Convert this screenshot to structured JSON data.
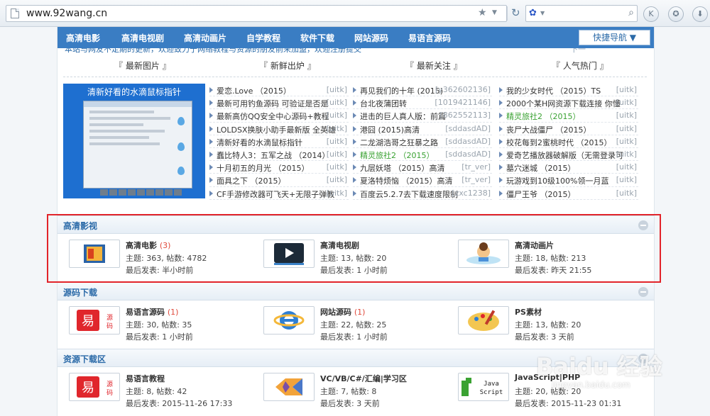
{
  "browser": {
    "url": "www.92wang.cn"
  },
  "nav": {
    "items": [
      "高清电影",
      "高清电视剧",
      "高清动画片",
      "自学教程",
      "软件下载",
      "网站源码",
      "易语言源码"
    ],
    "quick_nav": "快捷导航 ▼"
  },
  "marquee": {
    "left": "本站与网友不定期的更新，欢迎致力于网络教程与资源的朋友前来加盟，欢迎注册提交",
    "right": "下一"
  },
  "sections": [
    "『 最新图片 』",
    "『 新鲜出炉 』",
    "『 最新关注 』",
    "『 人气热门 』"
  ],
  "slide": {
    "caption": "清新好看的水滴鼠标指针"
  },
  "lists": {
    "fresh": [
      {
        "t": "爱恋.Love （2015）",
        "a": "[uitk]"
      },
      {
        "t": "最新可用钓鱼源码 可验证是否是",
        "a": "[uitk]"
      },
      {
        "t": "最新高仿QQ安全中心源码+教程",
        "a": "[uitk]"
      },
      {
        "t": "LOLDSX换肤小助手最新版 全英雄",
        "a": "[uitk]"
      },
      {
        "t": "清新好看的水滴鼠标指针",
        "a": "[uitk]"
      },
      {
        "t": "蠢比特人3：五军之战 （2014）",
        "a": "[uitk]"
      },
      {
        "t": "十月初五的月光 （2015）",
        "a": "[uitk]"
      },
      {
        "t": "面具之下 （2015）",
        "a": "[uitk]"
      },
      {
        "t": "CF手游修改器可飞天+无限子弹教",
        "a": "[uitk]"
      }
    ],
    "focus": [
      {
        "t": "再见我们的十年 (2015)",
        "a": "[y362602136]"
      },
      {
        "t": "台北夜蒲团转",
        "a": "[1019421146]"
      },
      {
        "t": "进击的巨人真人版：前篇",
        "a": "[862552113]"
      },
      {
        "t": "港囧 (2015)高清",
        "a": "[sddasdAD]"
      },
      {
        "t": "二龙湖浩哥之狂暴之路",
        "a": "[sddasdAD]"
      },
      {
        "t": "精灵旅社2 （2015）",
        "a": "[sddasdAD]",
        "green": true
      },
      {
        "t": "九层妖塔 （2015）高清",
        "a": "[tr_ver]"
      },
      {
        "t": "夏洛特烦恼 （2015）高清",
        "a": "[tr_ver]"
      },
      {
        "t": "百度云5.2.7去下载速度限制",
        "a": "[zxc1238]"
      }
    ],
    "hot": [
      {
        "t": "我的少女时代 （2015）TS",
        "a": "[uitk]"
      },
      {
        "t": "2000个某H网资源下载连接 你懂",
        "a": "[uitk]"
      },
      {
        "t": "精灵旅社2 （2015）",
        "a": "[uitk]",
        "green": true
      },
      {
        "t": "丧尸大战僵尸 （2015）",
        "a": "[uitk]"
      },
      {
        "t": "校花每到2蜜桃时代 （2015）",
        "a": "[uitk]"
      },
      {
        "t": "爱奇艺播放器破解版（无需登录可",
        "a": "[uitk]"
      },
      {
        "t": "墓穴迷城 （2015）",
        "a": "[uitk]"
      },
      {
        "t": "玩游戏到10级100%领一月蓝",
        "a": "[uitk]"
      },
      {
        "t": "僵尸王爷 （2015）",
        "a": "[uitk]"
      }
    ]
  },
  "categories": [
    {
      "name": "高清影视",
      "forums": [
        {
          "name": "高清电影",
          "count": "(3)",
          "stats": "主题: 363, 帖数: 4782",
          "last": "最后发表: 半小时前",
          "icon": "film-icon"
        },
        {
          "name": "高清电视剧",
          "count": "",
          "stats": "主题: 13, 帖数: 20",
          "last": "最后发表: 1 小时前",
          "icon": "play-icon"
        },
        {
          "name": "高清动画片",
          "count": "",
          "stats": "主题: 18, 帖数: 213",
          "last": "最后发表: 昨天 21:55",
          "icon": "cartoon-icon"
        }
      ]
    },
    {
      "name": "源码下载",
      "forums": [
        {
          "name": "易语言源码",
          "count": "(1)",
          "stats": "主题: 30, 帖数: 35",
          "last": "最后发表: 1 小时前",
          "icon": "yi-logo-icon"
        },
        {
          "name": "网站源码",
          "count": "(1)",
          "stats": "主题: 22, 帖数: 25",
          "last": "最后发表: 1 小时前",
          "icon": "ie-icon"
        },
        {
          "name": "PS素材",
          "count": "",
          "stats": "主题: 13, 帖数: 20",
          "last": "最后发表: 3 天前",
          "icon": "palette-icon"
        }
      ]
    },
    {
      "name": "资源下载区",
      "forums": [
        {
          "name": "易语言教程",
          "count": "",
          "stats": "主题: 8, 帖数: 42",
          "last": "最后发表: 2015-11-26 17:33",
          "icon": "yi-logo-icon"
        },
        {
          "name": "VC/VB/C#/汇编|学习区",
          "count": "",
          "stats": "主题: 7, 帖数: 8",
          "last": "最后发表: 3 天前",
          "icon": "vs-icon"
        },
        {
          "name": "JavaScript|PHP",
          "count": "",
          "stats": "主题: 20, 帖数: 20",
          "last": "最后发表: 2015-11-23 01:31",
          "icon": "java-script-icon"
        }
      ]
    }
  ],
  "watermark": {
    "text": "Baidu 经验",
    "sub": "jingyan.baidu.com"
  }
}
